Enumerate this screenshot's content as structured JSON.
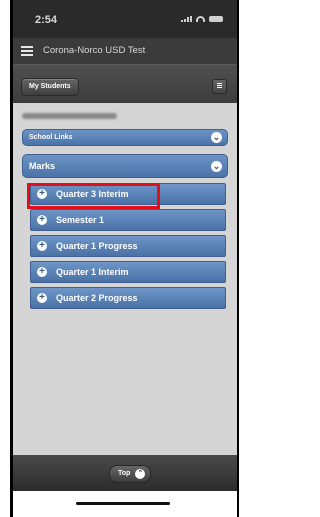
{
  "status_bar": {
    "time": "2:54"
  },
  "app": {
    "title": "Corona-Norco USD Test"
  },
  "toolbar": {
    "my_students_label": "My Students"
  },
  "sections": {
    "school_links_label": "School Links",
    "marks_label": "Marks"
  },
  "marks_items": [
    {
      "label": "Quarter 3 Interim"
    },
    {
      "label": "Semester 1"
    },
    {
      "label": "Quarter 1 Progress"
    },
    {
      "label": "Quarter 1 Interim"
    },
    {
      "label": "Quarter 2 Progress"
    }
  ],
  "footer": {
    "top_label": "Top"
  },
  "colors": {
    "accent": "#5a80b5",
    "highlight": "#e0101b"
  }
}
